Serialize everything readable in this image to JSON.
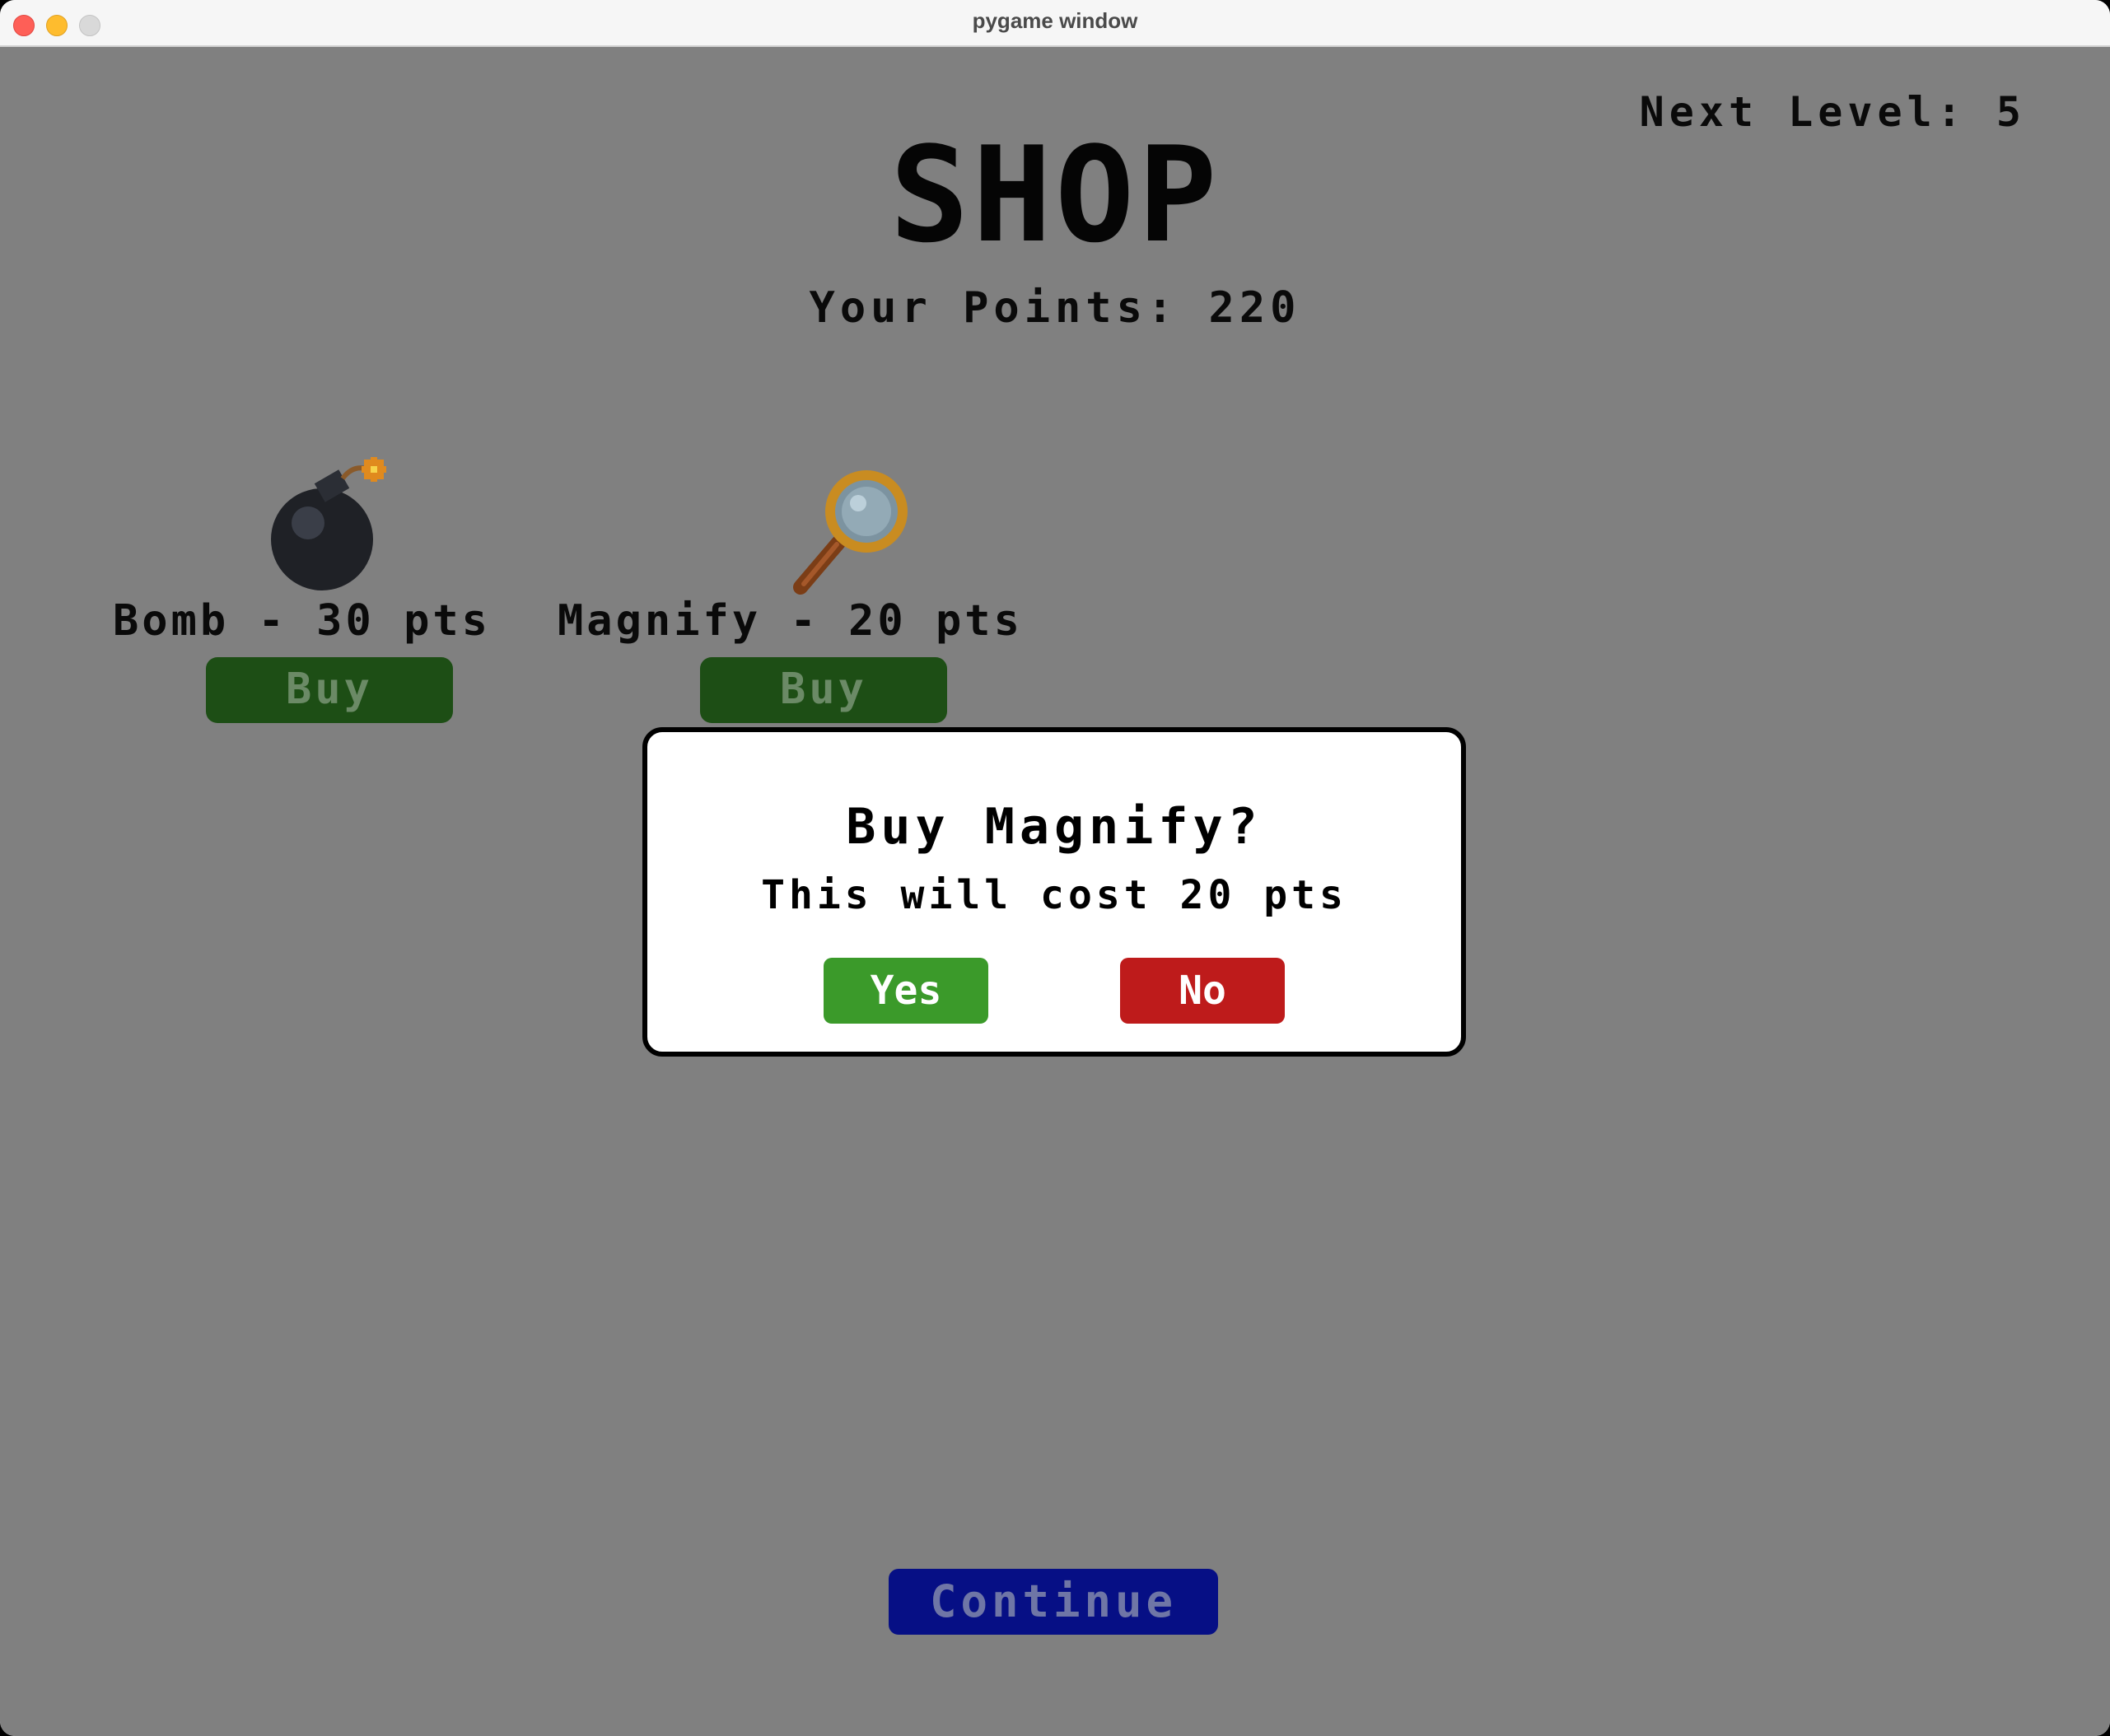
{
  "window": {
    "title": "pygame window"
  },
  "hud": {
    "next_level": "Next Level: 5"
  },
  "shop": {
    "title": "SHOP",
    "points": "Your Points: 220",
    "items": [
      {
        "label": "Bomb - 30 pts",
        "icon": "bomb-icon",
        "buy_label": "Buy"
      },
      {
        "label": "Magnify - 20 pts",
        "icon": "magnifying-glass-icon",
        "buy_label": "Buy"
      }
    ]
  },
  "dialog": {
    "title": "Buy Magnify?",
    "message": "This will cost 20 pts",
    "yes_label": "Yes",
    "no_label": "No"
  },
  "footer": {
    "continue_label": "Continue"
  },
  "colors": {
    "background": "#808080",
    "buy_button": "#1d4e15",
    "yes_button": "#3b9a2a",
    "no_button": "#be1b1b",
    "continue_button": "#060f85"
  }
}
